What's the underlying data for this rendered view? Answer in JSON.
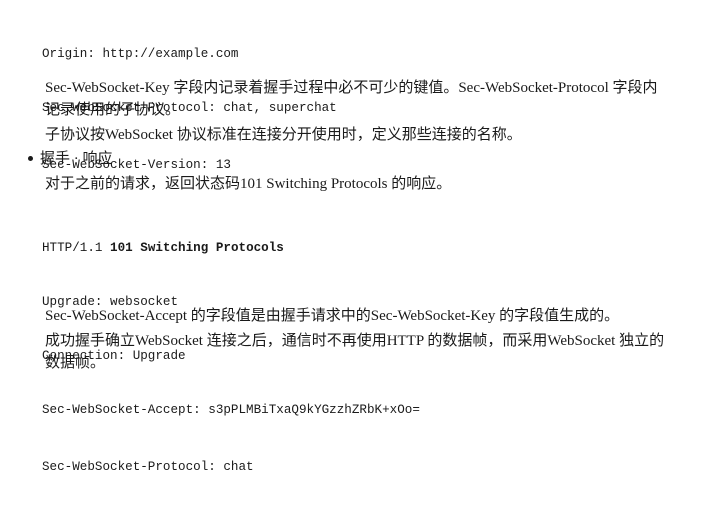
{
  "request_headers": [
    "Origin: http://example.com",
    "Sec-WebSocket-Protocol: chat, superchat",
    "Sec-WebSocket-Version: 13"
  ],
  "para_key_protocol": "Sec-WebSocket-Key 字段内记录着握手过程中必不可少的键值。Sec-WebSocket-Protocol 字段内记录使用的子协议。",
  "para_subprotocol": "子协议按WebSocket 协议标准在连接分开使用时，定义那些连接的名称。",
  "bullet_label": "握手 · 响应",
  "para_response_intro": "对于之前的请求，返回状态码101 Switching Protocols 的响应。",
  "response": {
    "status_prefix": "HTTP/1.1 ",
    "status_bold": "101 Switching Protocols",
    "headers": [
      "Upgrade: websocket",
      "Connection: Upgrade",
      "Sec-WebSocket-Accept: s3pPLMBiTxaQ9kYGzzhZRbK+xOo=",
      "Sec-WebSocket-Protocol: chat"
    ]
  },
  "para_accept": "Sec-WebSocket-Accept 的字段值是由握手请求中的Sec-WebSocket-Key 的字段值生成的。",
  "para_after": "成功握手确立WebSocket 连接之后，通信时不再使用HTTP 的数据帧，而采用WebSocket 独立的数据帧。"
}
